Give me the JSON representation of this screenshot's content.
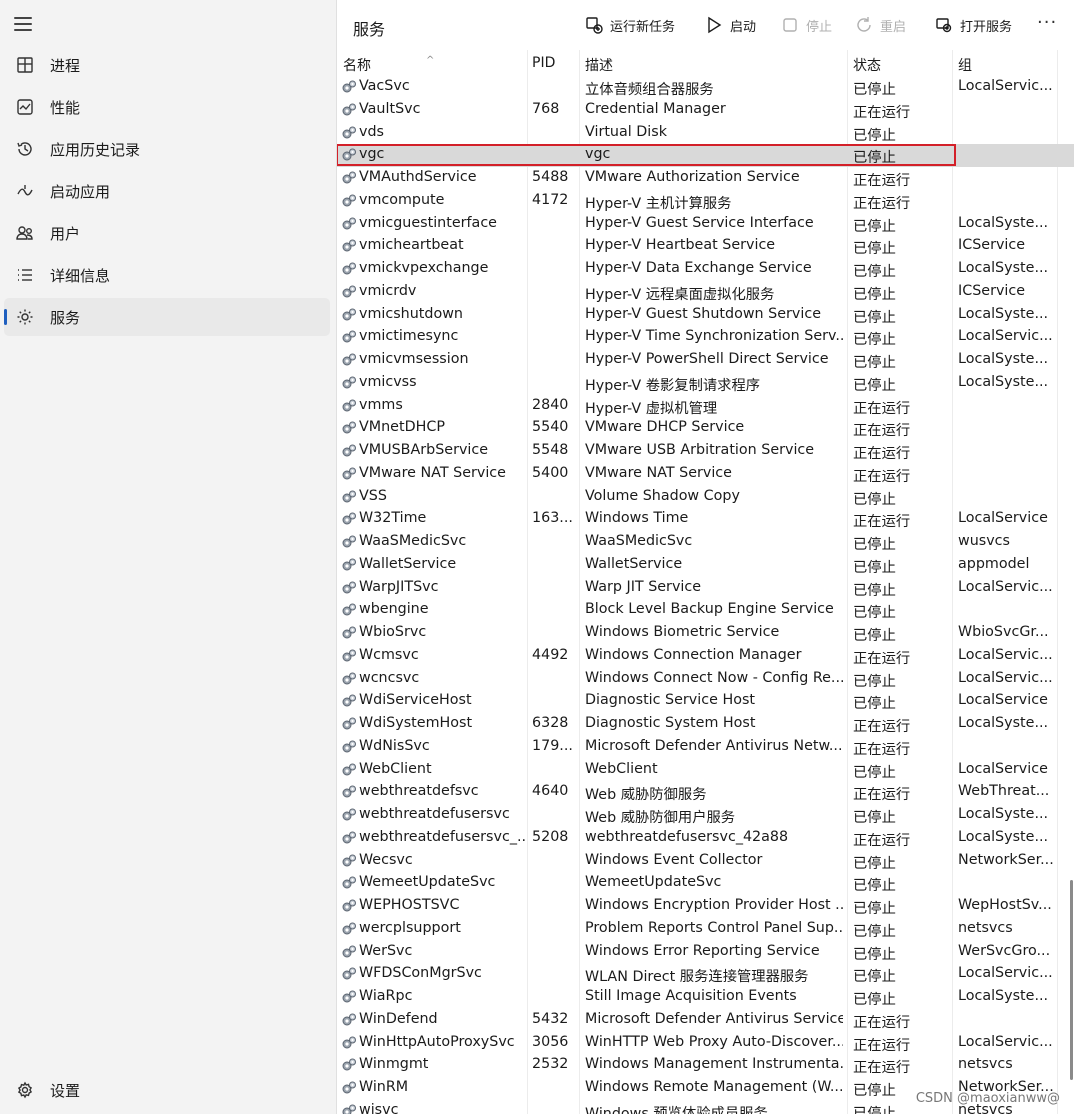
{
  "sidebar": {
    "items": [
      {
        "label": "进程",
        "icon": "processes-icon"
      },
      {
        "label": "性能",
        "icon": "performance-icon"
      },
      {
        "label": "应用历史记录",
        "icon": "app-history-icon"
      },
      {
        "label": "启动应用",
        "icon": "startup-apps-icon"
      },
      {
        "label": "用户",
        "icon": "users-icon"
      },
      {
        "label": "详细信息",
        "icon": "details-icon"
      },
      {
        "label": "服务",
        "icon": "services-icon",
        "active": true
      }
    ],
    "settings_label": "设置"
  },
  "toolbar": {
    "title": "服务",
    "run_new_task": "运行新任务",
    "start": "启动",
    "stop": "停止",
    "restart": "重启",
    "open_services": "打开服务",
    "more": "···"
  },
  "columns": {
    "name": "名称",
    "pid": "PID",
    "desc": "描述",
    "status": "状态",
    "group": "组"
  },
  "rows": [
    {
      "name": "VacSvc",
      "pid": "",
      "desc": "立体音频组合器服务",
      "status": "已停止",
      "group": "LocalServic..."
    },
    {
      "name": "VaultSvc",
      "pid": "768",
      "desc": "Credential Manager",
      "status": "正在运行",
      "group": ""
    },
    {
      "name": "vds",
      "pid": "",
      "desc": "Virtual Disk",
      "status": "已停止",
      "group": ""
    },
    {
      "name": "vgc",
      "pid": "",
      "desc": "vgc",
      "status": "已停止",
      "group": "",
      "selected": true
    },
    {
      "name": "VMAuthdService",
      "pid": "5488",
      "desc": "VMware Authorization Service",
      "status": "正在运行",
      "group": ""
    },
    {
      "name": "vmcompute",
      "pid": "4172",
      "desc": "Hyper-V 主机计算服务",
      "status": "正在运行",
      "group": ""
    },
    {
      "name": "vmicguestinterface",
      "pid": "",
      "desc": "Hyper-V Guest Service Interface",
      "status": "已停止",
      "group": "LocalSyste..."
    },
    {
      "name": "vmicheartbeat",
      "pid": "",
      "desc": "Hyper-V Heartbeat Service",
      "status": "已停止",
      "group": "ICService"
    },
    {
      "name": "vmickvpexchange",
      "pid": "",
      "desc": "Hyper-V Data Exchange Service",
      "status": "已停止",
      "group": "LocalSyste..."
    },
    {
      "name": "vmicrdv",
      "pid": "",
      "desc": "Hyper-V 远程桌面虚拟化服务",
      "status": "已停止",
      "group": "ICService"
    },
    {
      "name": "vmicshutdown",
      "pid": "",
      "desc": "Hyper-V Guest Shutdown Service",
      "status": "已停止",
      "group": "LocalSyste..."
    },
    {
      "name": "vmictimesync",
      "pid": "",
      "desc": "Hyper-V Time Synchronization Serv...",
      "status": "已停止",
      "group": "LocalServic..."
    },
    {
      "name": "vmicvmsession",
      "pid": "",
      "desc": "Hyper-V PowerShell Direct Service",
      "status": "已停止",
      "group": "LocalSyste..."
    },
    {
      "name": "vmicvss",
      "pid": "",
      "desc": "Hyper-V 卷影复制请求程序",
      "status": "已停止",
      "group": "LocalSyste..."
    },
    {
      "name": "vmms",
      "pid": "2840",
      "desc": "Hyper-V 虚拟机管理",
      "status": "正在运行",
      "group": ""
    },
    {
      "name": "VMnetDHCP",
      "pid": "5540",
      "desc": "VMware DHCP Service",
      "status": "正在运行",
      "group": ""
    },
    {
      "name": "VMUSBArbService",
      "pid": "5548",
      "desc": "VMware USB Arbitration Service",
      "status": "正在运行",
      "group": ""
    },
    {
      "name": "VMware NAT Service",
      "pid": "5400",
      "desc": "VMware NAT Service",
      "status": "正在运行",
      "group": ""
    },
    {
      "name": "VSS",
      "pid": "",
      "desc": "Volume Shadow Copy",
      "status": "已停止",
      "group": ""
    },
    {
      "name": "W32Time",
      "pid": "163...",
      "desc": "Windows Time",
      "status": "正在运行",
      "group": "LocalService"
    },
    {
      "name": "WaaSMedicSvc",
      "pid": "",
      "desc": "WaaSMedicSvc",
      "status": "已停止",
      "group": "wusvcs"
    },
    {
      "name": "WalletService",
      "pid": "",
      "desc": "WalletService",
      "status": "已停止",
      "group": "appmodel"
    },
    {
      "name": "WarpJITSvc",
      "pid": "",
      "desc": "Warp JIT Service",
      "status": "已停止",
      "group": "LocalServic..."
    },
    {
      "name": "wbengine",
      "pid": "",
      "desc": "Block Level Backup Engine Service",
      "status": "已停止",
      "group": ""
    },
    {
      "name": "WbioSrvc",
      "pid": "",
      "desc": "Windows Biometric Service",
      "status": "已停止",
      "group": "WbioSvcGr..."
    },
    {
      "name": "Wcmsvc",
      "pid": "4492",
      "desc": "Windows Connection Manager",
      "status": "正在运行",
      "group": "LocalServic..."
    },
    {
      "name": "wcncsvc",
      "pid": "",
      "desc": "Windows Connect Now - Config Re...",
      "status": "已停止",
      "group": "LocalServic..."
    },
    {
      "name": "WdiServiceHost",
      "pid": "",
      "desc": "Diagnostic Service Host",
      "status": "已停止",
      "group": "LocalService"
    },
    {
      "name": "WdiSystemHost",
      "pid": "6328",
      "desc": "Diagnostic System Host",
      "status": "正在运行",
      "group": "LocalSyste..."
    },
    {
      "name": "WdNisSvc",
      "pid": "179...",
      "desc": "Microsoft Defender Antivirus Netw...",
      "status": "正在运行",
      "group": ""
    },
    {
      "name": "WebClient",
      "pid": "",
      "desc": "WebClient",
      "status": "已停止",
      "group": "LocalService"
    },
    {
      "name": "webthreatdefsvc",
      "pid": "4640",
      "desc": "Web 威胁防御服务",
      "status": "正在运行",
      "group": "WebThreat..."
    },
    {
      "name": "webthreatdefusersvc",
      "pid": "",
      "desc": "Web 威胁防御用户服务",
      "status": "已停止",
      "group": "LocalSyste..."
    },
    {
      "name": "webthreatdefusersvc_...",
      "pid": "5208",
      "desc": "webthreatdefusersvc_42a88",
      "status": "正在运行",
      "group": "LocalSyste..."
    },
    {
      "name": "Wecsvc",
      "pid": "",
      "desc": "Windows Event Collector",
      "status": "已停止",
      "group": "NetworkSer..."
    },
    {
      "name": "WemeetUpdateSvc",
      "pid": "",
      "desc": "WemeetUpdateSvc",
      "status": "已停止",
      "group": ""
    },
    {
      "name": "WEPHOSTSVC",
      "pid": "",
      "desc": "Windows Encryption Provider Host ...",
      "status": "已停止",
      "group": "WepHostSv..."
    },
    {
      "name": "wercplsupport",
      "pid": "",
      "desc": "Problem Reports Control Panel Sup...",
      "status": "已停止",
      "group": "netsvcs"
    },
    {
      "name": "WerSvc",
      "pid": "",
      "desc": "Windows Error Reporting Service",
      "status": "已停止",
      "group": "WerSvcGro..."
    },
    {
      "name": "WFDSConMgrSvc",
      "pid": "",
      "desc": "WLAN Direct 服务连接管理器服务",
      "status": "已停止",
      "group": "LocalServic..."
    },
    {
      "name": "WiaRpc",
      "pid": "",
      "desc": "Still Image Acquisition Events",
      "status": "已停止",
      "group": "LocalSyste..."
    },
    {
      "name": "WinDefend",
      "pid": "5432",
      "desc": "Microsoft Defender Antivirus Service",
      "status": "正在运行",
      "group": ""
    },
    {
      "name": "WinHttpAutoProxySvc",
      "pid": "3056",
      "desc": "WinHTTP Web Proxy Auto-Discover...",
      "status": "正在运行",
      "group": "LocalServic..."
    },
    {
      "name": "Winmgmt",
      "pid": "2532",
      "desc": "Windows Management Instrumenta...",
      "status": "正在运行",
      "group": "netsvcs"
    },
    {
      "name": "WinRM",
      "pid": "",
      "desc": "Windows Remote Management (W...",
      "status": "已停止",
      "group": "NetworkSer..."
    },
    {
      "name": "wisvc",
      "pid": "",
      "desc": "Windows 预览体验成员服务",
      "status": "已停止",
      "group": "netsvcs"
    }
  ],
  "watermark": "CSDN @maoxianww@",
  "colors": {
    "accent": "#1f5fbf",
    "selection_outline": "#d32029",
    "selected_row": "#d9d9d9"
  }
}
